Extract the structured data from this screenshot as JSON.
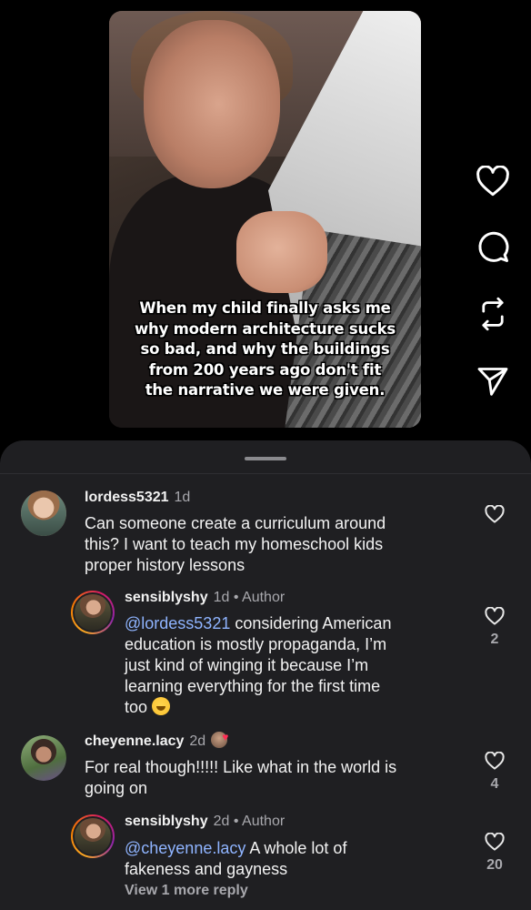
{
  "video": {
    "caption_lines": [
      "When my child finally asks me",
      "why modern architecture sucks",
      "so bad, and why the buildings",
      "from 200 years ago don't fit",
      "the narrative we were given."
    ]
  },
  "actions": {
    "icons": [
      "heart-icon",
      "comment-icon",
      "repost-icon",
      "send-icon"
    ]
  },
  "comments": [
    {
      "username": "lordess5321",
      "time": "1d",
      "text": "Can someone create a curriculum around this? I want to teach my homeschool kids proper history lessons",
      "text_lines": [
        "Can someone create a curriculum around",
        "this? I want to teach my homeschool kids",
        "proper history lessons"
      ],
      "likes": ""
    },
    {
      "username": "sensiblyshy",
      "time": "1d",
      "author_tag": "• Author",
      "mention": "@lordess5321",
      "text_lines": [
        "considering American",
        "education is mostly propaganda, I’m",
        "just kind of winging it because I’m",
        "learning everything for the first time",
        "too"
      ],
      "likes": "2"
    },
    {
      "username": "cheyenne.lacy",
      "time": "2d",
      "text_lines": [
        "For real though!!!!! Like what in the world is",
        "going on"
      ],
      "likes": "4"
    },
    {
      "username": "sensiblyshy",
      "time": "2d",
      "author_tag": "• Author",
      "mention": "@cheyenne.lacy",
      "text_lines": [
        "A whole lot of",
        "fakeness and gayness"
      ],
      "likes": "20",
      "view_more": "View 1 more reply"
    }
  ],
  "colors": {
    "sheet_bg": "#1f1f22",
    "mention": "#8fb4ff",
    "secondary_text": "#a8a8ad"
  }
}
